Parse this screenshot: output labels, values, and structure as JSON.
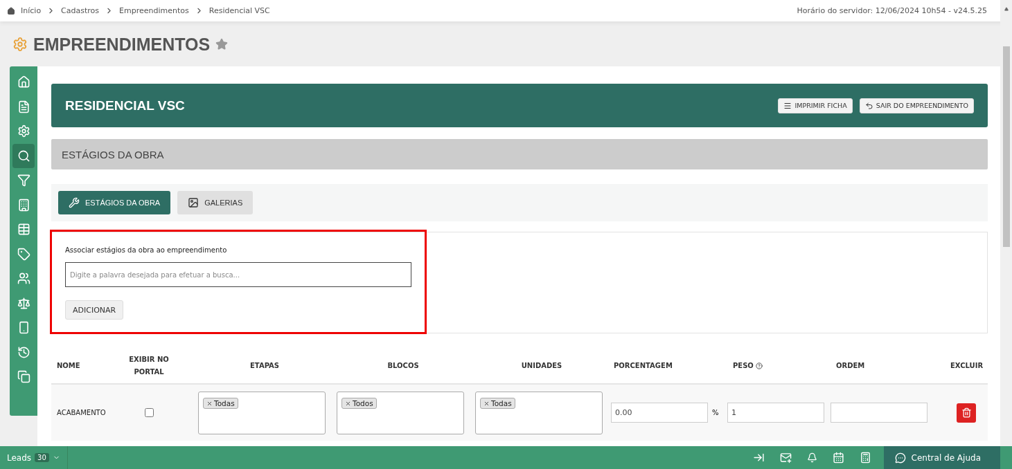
{
  "breadcrumb": [
    "Início",
    "Cadastros",
    "Empreendimentos",
    "Residencial VSC"
  ],
  "server_info": "Horário do servidor: 12/06/2024 10h54 - v24.5.25",
  "page_title": "EMPREENDIMENTOS",
  "sidebar": {
    "items": [
      {
        "selected": false
      },
      {
        "selected": false
      },
      {
        "selected": false
      },
      {
        "selected": true
      },
      {
        "selected": false
      },
      {
        "selected": false
      },
      {
        "selected": false
      },
      {
        "selected": false
      },
      {
        "selected": false
      },
      {
        "selected": false
      },
      {
        "selected": false
      },
      {
        "selected": false
      },
      {
        "selected": false
      }
    ]
  },
  "header": {
    "title": "RESIDENCIAL VSC",
    "buttons": [
      "IMPRIMIR FICHA",
      "SAIR DO EMPREENDIMENTO"
    ]
  },
  "section_title": "ESTÁGIOS DA OBRA",
  "tabs": [
    {
      "label": "ESTÁGIOS DA OBRA",
      "selected": true
    },
    {
      "label": "GALERIAS",
      "selected": false
    }
  ],
  "form": {
    "label": "Associar estágios da obra ao empreendimento",
    "placeholder": "Digite a palavra desejada para efetuar a busca...",
    "button": "ADICIONAR"
  },
  "table": {
    "columns": [
      "NOME",
      "EXIBIR NO PORTAL",
      "ETAPAS",
      "BLOCOS",
      "UNIDADES",
      "PORCENTAGEM",
      "PESO",
      "ORDEM",
      "EXCLUIR"
    ],
    "rows": [
      {
        "name": "ACABAMENTO",
        "portal": false,
        "etapas": [
          "Todas"
        ],
        "blocos": [
          "Todos"
        ],
        "unidades": [
          "Todas"
        ],
        "porcentagem": "0.00",
        "percent_sign": "%",
        "peso": "1"
      }
    ]
  },
  "bottom_bar": {
    "leads_label": "Leads",
    "leads_count": "30",
    "help": "Central de Ajuda"
  }
}
